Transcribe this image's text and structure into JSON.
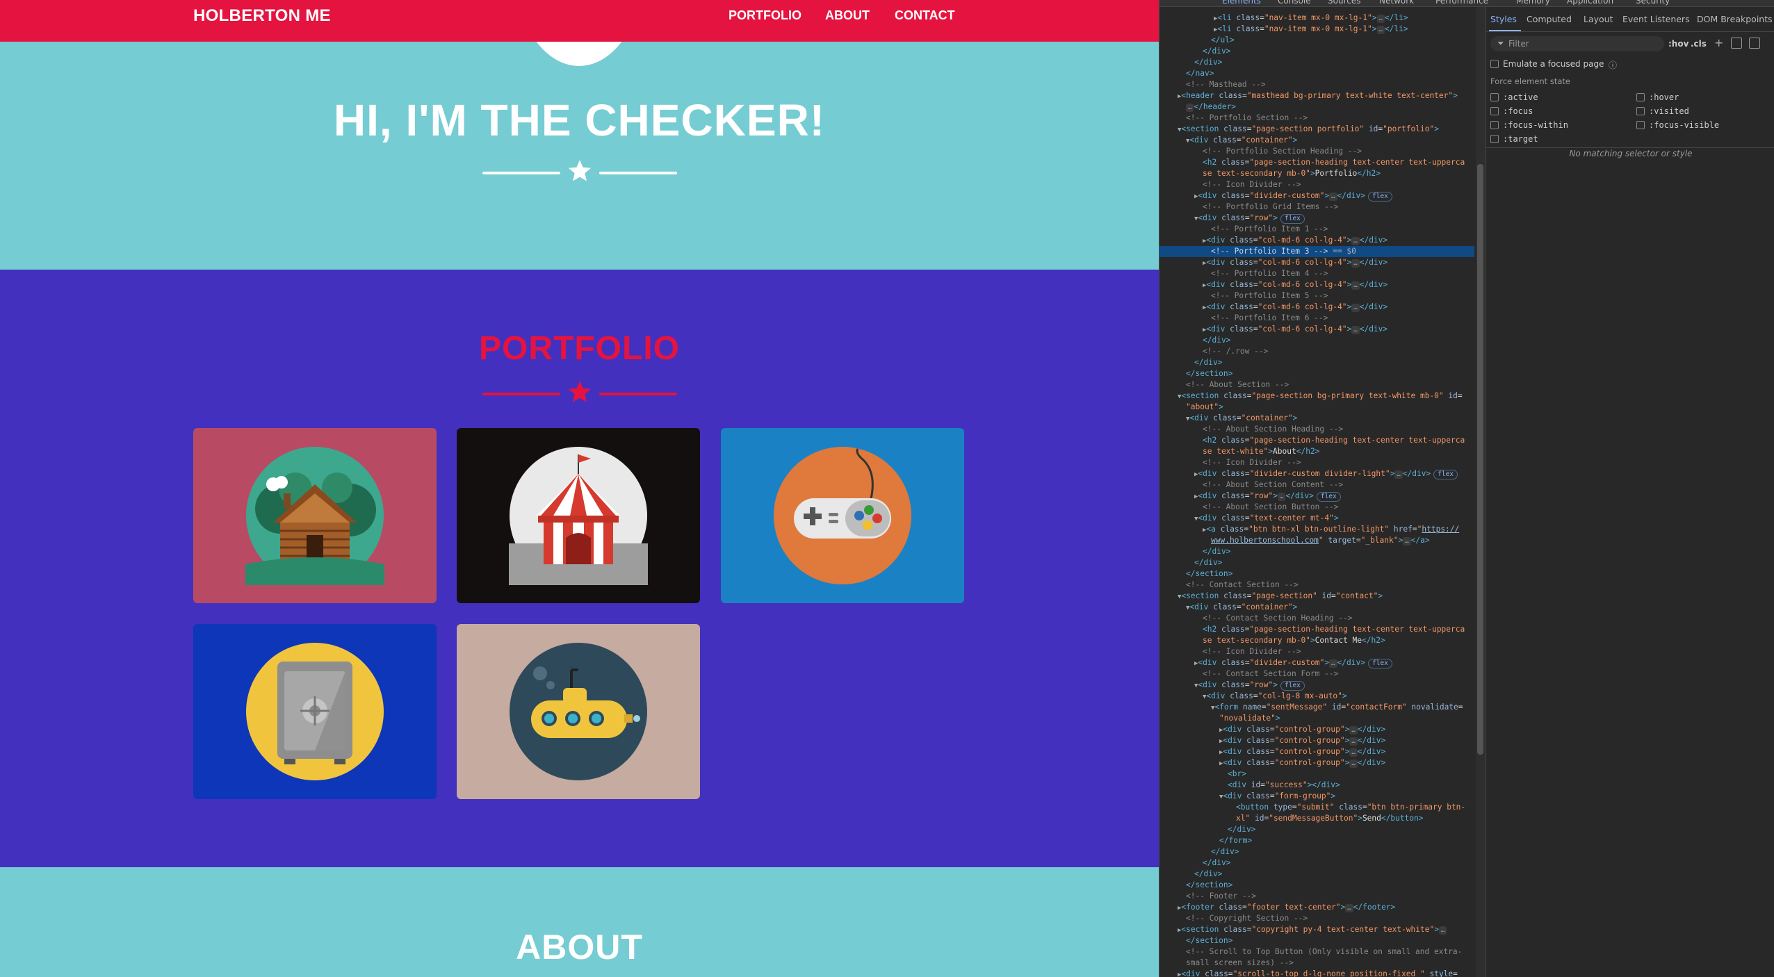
{
  "site": {
    "brand": "HOLBERTON ME",
    "nav": [
      "PORTFOLIO",
      "ABOUT",
      "CONTACT"
    ],
    "masthead_title": "HI, I'M THE CHECKER!",
    "portfolio_title": "PORTFOLIO",
    "about_title": "ABOUT",
    "colors": {
      "primary": "#e5133f",
      "masthead_bg": "#76ccd3",
      "portfolio_bg": "#4330be"
    },
    "portfolio_items": [
      {
        "name": "cabin",
        "bg": "#b94a64"
      },
      {
        "name": "circus-tent",
        "bg": "#140f0f"
      },
      {
        "name": "game-controller",
        "bg": "#1a82c4"
      },
      {
        "name": "safe",
        "bg": "#0e36b8"
      },
      {
        "name": "submarine",
        "bg": "#c6aba0"
      }
    ]
  },
  "devtools": {
    "top_tabs": [
      "Elements",
      "Console",
      "Sources",
      "Network",
      "Performance",
      "Memory",
      "Application",
      "Security"
    ],
    "styles_tabs": [
      "Styles",
      "Computed",
      "Layout",
      "Event Listeners",
      "DOM Breakpoints"
    ],
    "filter_placeholder": "Filter",
    "hov": ":hov",
    "cls": ".cls",
    "emulate_focus": "Emulate a focused page",
    "force_state_title": "Force element state",
    "states_left": [
      ":active",
      ":focus",
      ":focus-within",
      ":target"
    ],
    "states_right": [
      ":hover",
      ":visited",
      ":focus-visible"
    ],
    "no_match": "No matching selector or style",
    "selected_suffix": "== $0"
  }
}
